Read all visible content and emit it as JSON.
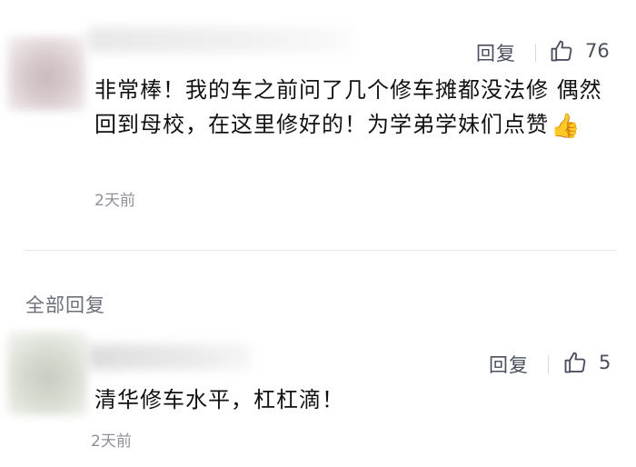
{
  "comments": [
    {
      "reply_label": "回复",
      "like_count": "76",
      "text": "非常棒！我的车之前问了几个修车摊都没法修 偶然回到母校，在这里修好的！为学弟学妹们点赞",
      "emoji_icon": "thumbs-up-emoji",
      "emoji_char": "👍",
      "timestamp": "2天前"
    },
    {
      "reply_label": "回复",
      "like_count": "5",
      "text": "清华修车水平，杠杠滴！",
      "timestamp": "2天前"
    }
  ],
  "section_label": "全部回复",
  "colors": {
    "text_primary": "#111111",
    "text_secondary": "#4a4f5e",
    "text_muted": "#8e9099",
    "divider": "#e6e7ea"
  }
}
